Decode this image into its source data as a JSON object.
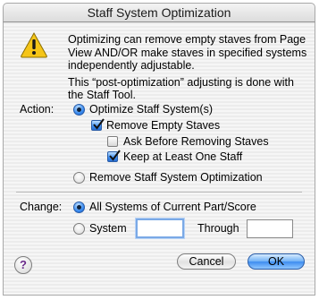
{
  "dialog": {
    "title": "Staff System Optimization",
    "message_line1": "Optimizing can remove empty staves from Page",
    "message_line2": "View AND/OR make staves in specified systems",
    "message_line3": "independently adjustable.",
    "message_line4": "This “post-optimization” adjusting is done with",
    "message_line5": "the Staff Tool."
  },
  "action": {
    "label": "Action:",
    "optimize_label": "Optimize Staff System(s)",
    "remove_empty_label": "Remove Empty Staves",
    "ask_before_label": "Ask Before Removing Staves",
    "keep_one_label": "Keep at Least One Staff",
    "remove_optimization_label": "Remove Staff System Optimization",
    "optimize_selected": true,
    "remove_empty_checked": true,
    "ask_before_checked": false,
    "keep_one_checked": true,
    "remove_optimization_selected": false
  },
  "change": {
    "label": "Change:",
    "all_systems_label": "All Systems of Current Part/Score",
    "system_label": "System",
    "through_label": "Through",
    "system_value": "",
    "through_value": "",
    "all_systems_selected": true,
    "system_selected": false
  },
  "buttons": {
    "help_label": "?",
    "cancel_label": "Cancel",
    "ok_label": "OK"
  },
  "colors": {
    "accent": "#3d8cf0",
    "warning": "#f5c518"
  }
}
